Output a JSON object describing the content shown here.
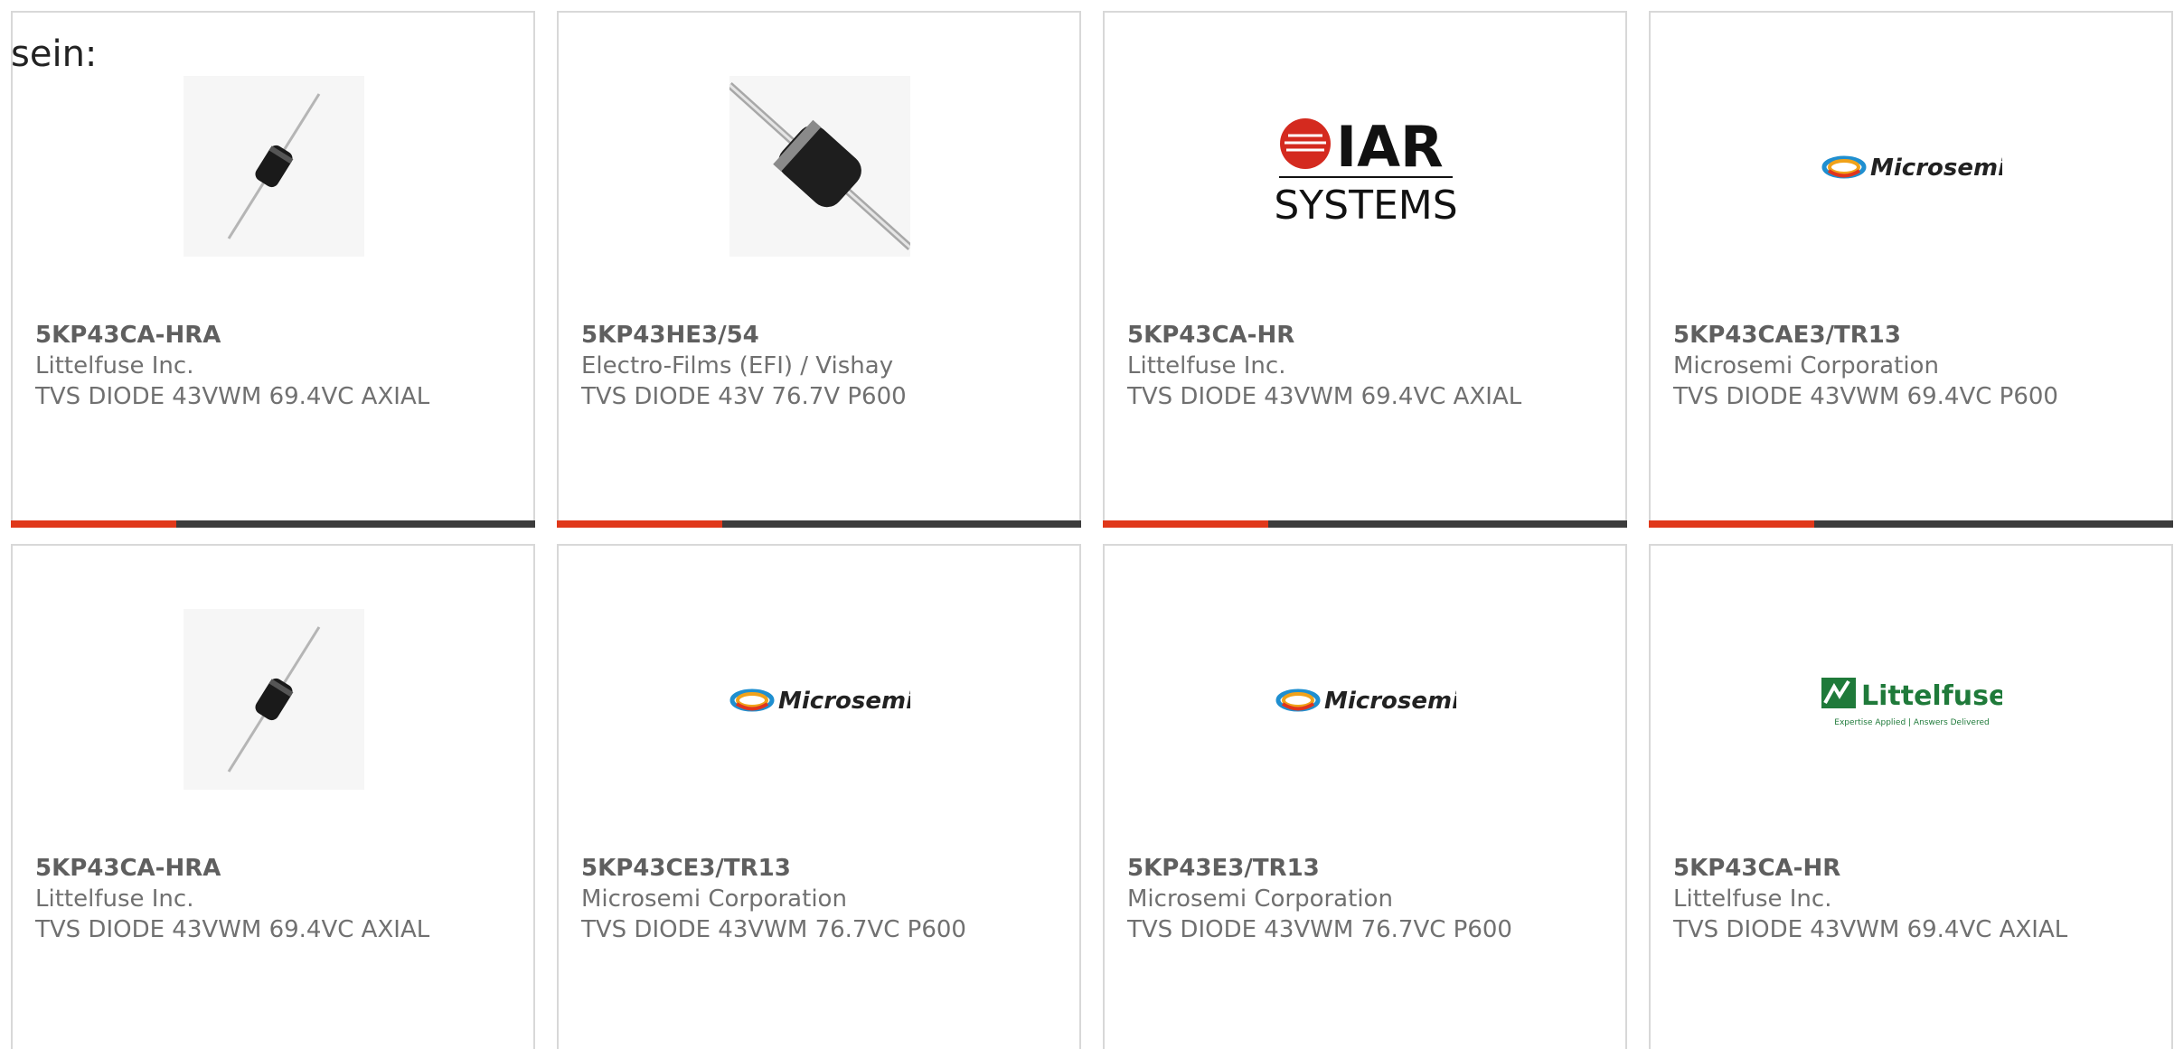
{
  "lead_text": "sein:",
  "colors": {
    "accent": "#e0381a",
    "bar": "#3c3c3c",
    "border": "#d8d8d8",
    "text": "#707070"
  },
  "cards": [
    {
      "part": "5KP43CA-HRA",
      "mfr": "Littelfuse Inc.",
      "desc": "TVS DIODE 43VWM 69.4VC AXIAL",
      "image": "axial-diode-small"
    },
    {
      "part": "5KP43HE3/54",
      "mfr": "Electro-Films (EFI) / Vishay",
      "desc": "TVS DIODE 43V 76.7V P600",
      "image": "axial-diode-large"
    },
    {
      "part": "5KP43CA-HR",
      "mfr": "Littelfuse Inc.",
      "desc": "TVS DIODE 43VWM 69.4VC AXIAL",
      "image": "iar-systems-logo",
      "logo_text": [
        "IAR",
        "SYSTEMS"
      ]
    },
    {
      "part": "5KP43CAE3/TR13",
      "mfr": "Microsemi Corporation",
      "desc": "TVS DIODE 43VWM 69.4VC P600",
      "image": "microsemi-logo",
      "logo_text": [
        "Microsemi"
      ]
    },
    {
      "part": "5KP43CA-HRA",
      "mfr": "Littelfuse Inc.",
      "desc": "TVS DIODE 43VWM 69.4VC AXIAL",
      "image": "axial-diode-small"
    },
    {
      "part": "5KP43CE3/TR13",
      "mfr": "Microsemi Corporation",
      "desc": "TVS DIODE 43VWM 76.7VC P600",
      "image": "microsemi-logo",
      "logo_text": [
        "Microsemi"
      ]
    },
    {
      "part": "5KP43E3/TR13",
      "mfr": "Microsemi Corporation",
      "desc": "TVS DIODE 43VWM 76.7VC P600",
      "image": "microsemi-logo",
      "logo_text": [
        "Microsemi"
      ]
    },
    {
      "part": "5KP43CA-HR",
      "mfr": "Littelfuse Inc.",
      "desc": "TVS DIODE 43VWM 69.4VC AXIAL",
      "image": "littelfuse-logo",
      "logo_text": [
        "Littelfuse",
        "Expertise Applied | Answers Delivered"
      ]
    }
  ]
}
